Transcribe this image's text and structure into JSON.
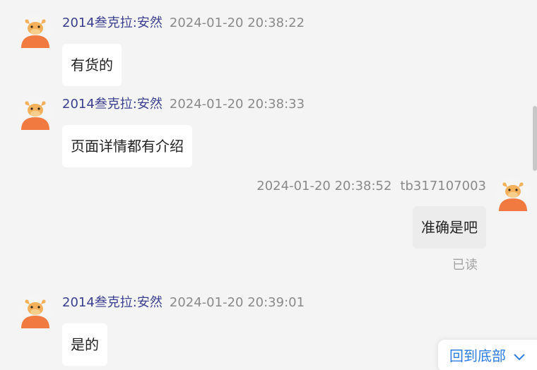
{
  "messages": [
    {
      "sender": "2014叁克拉:安然",
      "time": "2024-01-20 20:38:22",
      "text": "有货的"
    },
    {
      "sender": "2014叁克拉:安然",
      "time": "2024-01-20 20:38:33",
      "text": "页面详情都有介绍"
    },
    {
      "sender": "tb317107003",
      "time": "2024-01-20 20:38:52",
      "text": "准确是吧",
      "status": "已读"
    },
    {
      "sender": "2014叁克拉:安然",
      "time": "2024-01-20 20:39:01",
      "text": "是的"
    }
  ],
  "scroll_to_bottom": {
    "label": "回到底部",
    "icon": "chevron-down-icon"
  },
  "colors": {
    "background": "#f4f4f4",
    "sender_name": "#3b3f8f",
    "timestamp": "#8a8a8a",
    "link": "#2f7de1",
    "avatar": "#f07a3f"
  }
}
